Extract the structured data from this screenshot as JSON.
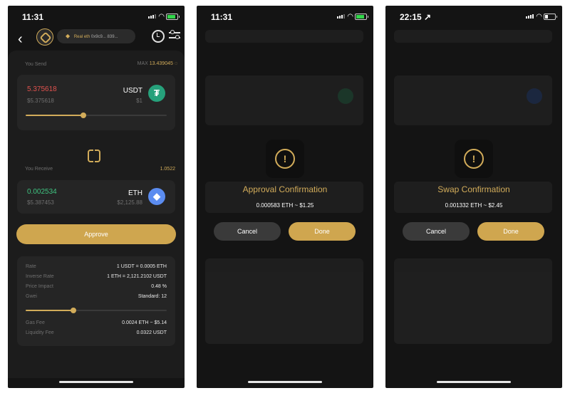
{
  "phone1": {
    "status": {
      "time": "11:31"
    },
    "wallet_pill": {
      "eth_symbol": "◆",
      "name": "Real eth",
      "address": "0x9c9... 839..."
    },
    "send": {
      "label": "You Send",
      "max_label": "MAX",
      "max_value": "13.439045",
      "amount": "5.375618",
      "usd": "$5.375618",
      "token": "USDT",
      "price": "$1",
      "icon": "tether-icon",
      "slider_fraction": 0.41
    },
    "receive": {
      "label": "You Receive",
      "right_value": "1.0522",
      "amount": "0.002534",
      "usd": "$5.387453",
      "token": "ETH",
      "price": "$2,125.88",
      "icon": "ethereum-icon"
    },
    "approve_label": "Approve",
    "details": [
      {
        "k": "Rate",
        "v": "1 USDT = 0.0005 ETH"
      },
      {
        "k": "Inverse Rate",
        "v": "1 ETH = 2,121.2102 USDT"
      },
      {
        "k": "Price Impact",
        "v": "0.48 %"
      },
      {
        "k": "Gwei",
        "v": "Standard: 12"
      }
    ],
    "gwei_slider_fraction": 0.34,
    "fees": [
      {
        "k": "Gas Fee",
        "v": "0.0024 ETH ~ $5.14"
      },
      {
        "k": "Liquidity Fee",
        "v": "0.0322 USDT"
      }
    ]
  },
  "phone2": {
    "status": {
      "time": "11:31"
    },
    "title": "Approval Confirmation",
    "subtitle": "0.000583 ETH ~ $1.25",
    "cancel_label": "Cancel",
    "done_label": "Done"
  },
  "phone3": {
    "status": {
      "time": "22:15 ↗"
    },
    "title": "Swap Confirmation",
    "subtitle": "0.001332 ETH ~ $2.45",
    "cancel_label": "Cancel",
    "done_label": "Done"
  },
  "colors": {
    "accent_gold": "#d2ac5a",
    "button_gold": "#cfa64f",
    "send_amount_red": "#e0524e",
    "receive_amount_green": "#3fc380",
    "tether_green": "#26a17b",
    "eth_blue": "#5b8cf0",
    "battery_green": "#32d74b"
  }
}
